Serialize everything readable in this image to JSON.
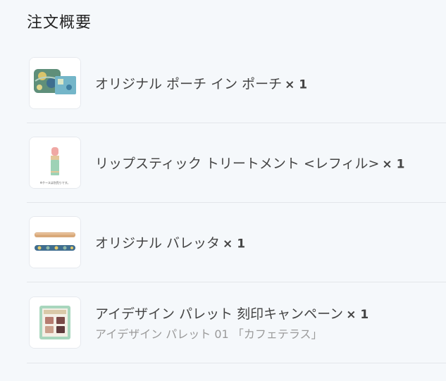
{
  "section_title": "注文概要",
  "items": [
    {
      "name": "オリジナル ポーチ イン ポーチ",
      "qty": "× 1",
      "icon": "pouch-image"
    },
    {
      "name": "リップスティック トリートメント <レフィル>",
      "qty": "× 1",
      "icon": "lipstick-image",
      "image_caption": "※ケースは別売りです。"
    },
    {
      "name": "オリジナル バレッタ",
      "qty": "× 1",
      "icon": "barrette-image"
    },
    {
      "name": "アイデザイン パレット 刻印キャンペーン",
      "qty": "× 1",
      "sub": "アイデザイン パレット 01 「カフェテラス」",
      "icon": "palette-image"
    }
  ]
}
